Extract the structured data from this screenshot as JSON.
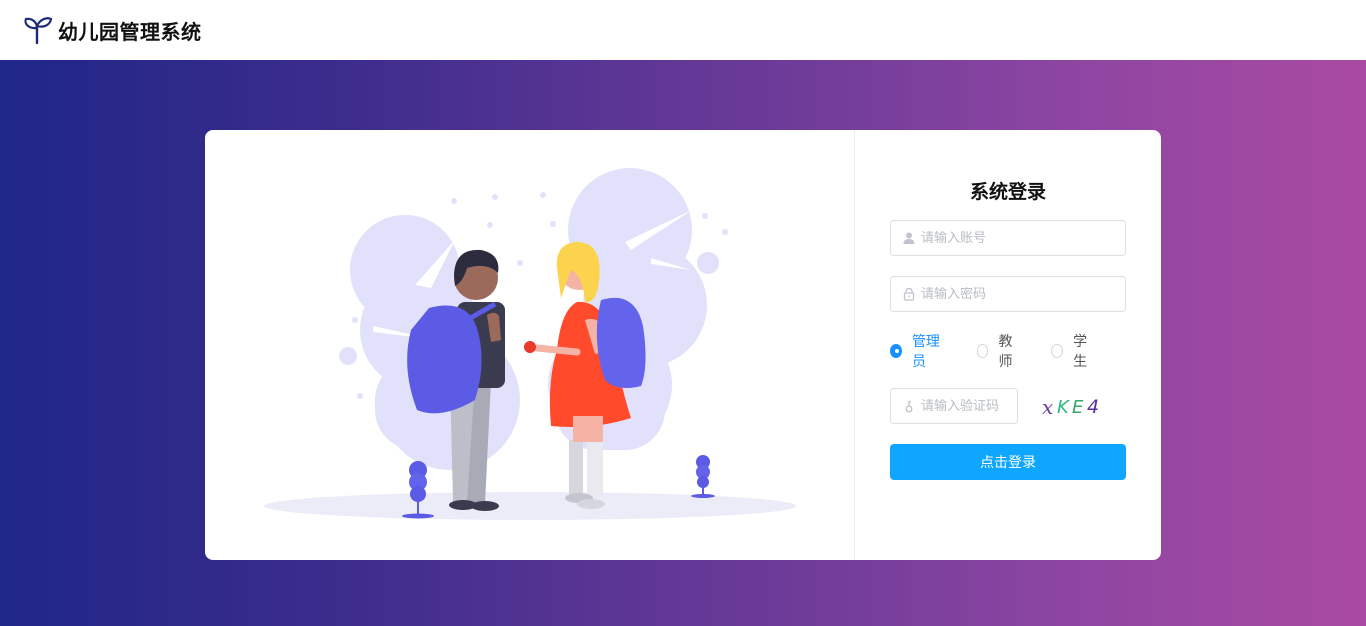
{
  "header": {
    "app_title": "幼儿园管理系统"
  },
  "login": {
    "title": "系统登录",
    "username_placeholder": "请输入账号",
    "password_placeholder": "请输入密码",
    "captcha_placeholder": "请输入验证码",
    "captcha_text": "xKE4",
    "roles": [
      {
        "label": "管理员",
        "selected": true
      },
      {
        "label": "教师",
        "selected": false
      },
      {
        "label": "学生",
        "selected": false
      }
    ],
    "submit_label": "点击登录"
  },
  "colors": {
    "accent": "#0ea6ff",
    "radio_active": "#1890ff",
    "gradient_start": "#1f2788",
    "gradient_end": "#aa4aa2"
  }
}
